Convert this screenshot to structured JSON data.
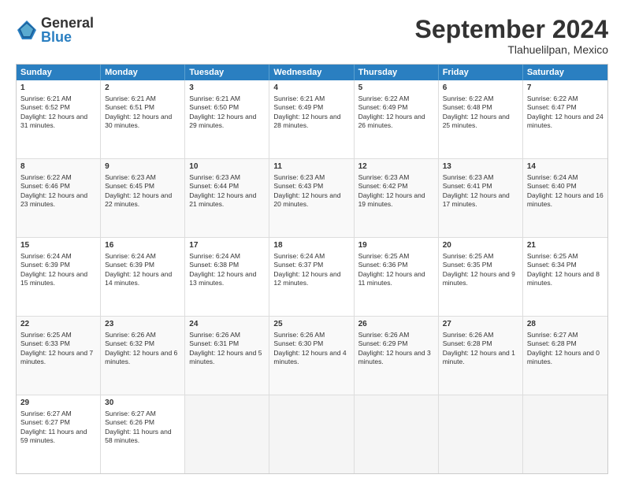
{
  "header": {
    "logo_general": "General",
    "logo_blue": "Blue",
    "title": "September 2024",
    "subtitle": "Tlahuelilpan, Mexico"
  },
  "days": [
    "Sunday",
    "Monday",
    "Tuesday",
    "Wednesday",
    "Thursday",
    "Friday",
    "Saturday"
  ],
  "weeks": [
    [
      {
        "day": "1",
        "info": "Sunrise: 6:21 AM\nSunset: 6:52 PM\nDaylight: 12 hours and 31 minutes."
      },
      {
        "day": "2",
        "info": "Sunrise: 6:21 AM\nSunset: 6:51 PM\nDaylight: 12 hours and 30 minutes."
      },
      {
        "day": "3",
        "info": "Sunrise: 6:21 AM\nSunset: 6:50 PM\nDaylight: 12 hours and 29 minutes."
      },
      {
        "day": "4",
        "info": "Sunrise: 6:21 AM\nSunset: 6:49 PM\nDaylight: 12 hours and 28 minutes."
      },
      {
        "day": "5",
        "info": "Sunrise: 6:22 AM\nSunset: 6:49 PM\nDaylight: 12 hours and 26 minutes."
      },
      {
        "day": "6",
        "info": "Sunrise: 6:22 AM\nSunset: 6:48 PM\nDaylight: 12 hours and 25 minutes."
      },
      {
        "day": "7",
        "info": "Sunrise: 6:22 AM\nSunset: 6:47 PM\nDaylight: 12 hours and 24 minutes."
      }
    ],
    [
      {
        "day": "8",
        "info": "Sunrise: 6:22 AM\nSunset: 6:46 PM\nDaylight: 12 hours and 23 minutes."
      },
      {
        "day": "9",
        "info": "Sunrise: 6:23 AM\nSunset: 6:45 PM\nDaylight: 12 hours and 22 minutes."
      },
      {
        "day": "10",
        "info": "Sunrise: 6:23 AM\nSunset: 6:44 PM\nDaylight: 12 hours and 21 minutes."
      },
      {
        "day": "11",
        "info": "Sunrise: 6:23 AM\nSunset: 6:43 PM\nDaylight: 12 hours and 20 minutes."
      },
      {
        "day": "12",
        "info": "Sunrise: 6:23 AM\nSunset: 6:42 PM\nDaylight: 12 hours and 19 minutes."
      },
      {
        "day": "13",
        "info": "Sunrise: 6:23 AM\nSunset: 6:41 PM\nDaylight: 12 hours and 17 minutes."
      },
      {
        "day": "14",
        "info": "Sunrise: 6:24 AM\nSunset: 6:40 PM\nDaylight: 12 hours and 16 minutes."
      }
    ],
    [
      {
        "day": "15",
        "info": "Sunrise: 6:24 AM\nSunset: 6:39 PM\nDaylight: 12 hours and 15 minutes."
      },
      {
        "day": "16",
        "info": "Sunrise: 6:24 AM\nSunset: 6:39 PM\nDaylight: 12 hours and 14 minutes."
      },
      {
        "day": "17",
        "info": "Sunrise: 6:24 AM\nSunset: 6:38 PM\nDaylight: 12 hours and 13 minutes."
      },
      {
        "day": "18",
        "info": "Sunrise: 6:24 AM\nSunset: 6:37 PM\nDaylight: 12 hours and 12 minutes."
      },
      {
        "day": "19",
        "info": "Sunrise: 6:25 AM\nSunset: 6:36 PM\nDaylight: 12 hours and 11 minutes."
      },
      {
        "day": "20",
        "info": "Sunrise: 6:25 AM\nSunset: 6:35 PM\nDaylight: 12 hours and 9 minutes."
      },
      {
        "day": "21",
        "info": "Sunrise: 6:25 AM\nSunset: 6:34 PM\nDaylight: 12 hours and 8 minutes."
      }
    ],
    [
      {
        "day": "22",
        "info": "Sunrise: 6:25 AM\nSunset: 6:33 PM\nDaylight: 12 hours and 7 minutes."
      },
      {
        "day": "23",
        "info": "Sunrise: 6:26 AM\nSunset: 6:32 PM\nDaylight: 12 hours and 6 minutes."
      },
      {
        "day": "24",
        "info": "Sunrise: 6:26 AM\nSunset: 6:31 PM\nDaylight: 12 hours and 5 minutes."
      },
      {
        "day": "25",
        "info": "Sunrise: 6:26 AM\nSunset: 6:30 PM\nDaylight: 12 hours and 4 minutes."
      },
      {
        "day": "26",
        "info": "Sunrise: 6:26 AM\nSunset: 6:29 PM\nDaylight: 12 hours and 3 minutes."
      },
      {
        "day": "27",
        "info": "Sunrise: 6:26 AM\nSunset: 6:28 PM\nDaylight: 12 hours and 1 minute."
      },
      {
        "day": "28",
        "info": "Sunrise: 6:27 AM\nSunset: 6:28 PM\nDaylight: 12 hours and 0 minutes."
      }
    ],
    [
      {
        "day": "29",
        "info": "Sunrise: 6:27 AM\nSunset: 6:27 PM\nDaylight: 11 hours and 59 minutes."
      },
      {
        "day": "30",
        "info": "Sunrise: 6:27 AM\nSunset: 6:26 PM\nDaylight: 11 hours and 58 minutes."
      },
      {
        "day": "",
        "info": ""
      },
      {
        "day": "",
        "info": ""
      },
      {
        "day": "",
        "info": ""
      },
      {
        "day": "",
        "info": ""
      },
      {
        "day": "",
        "info": ""
      }
    ]
  ]
}
